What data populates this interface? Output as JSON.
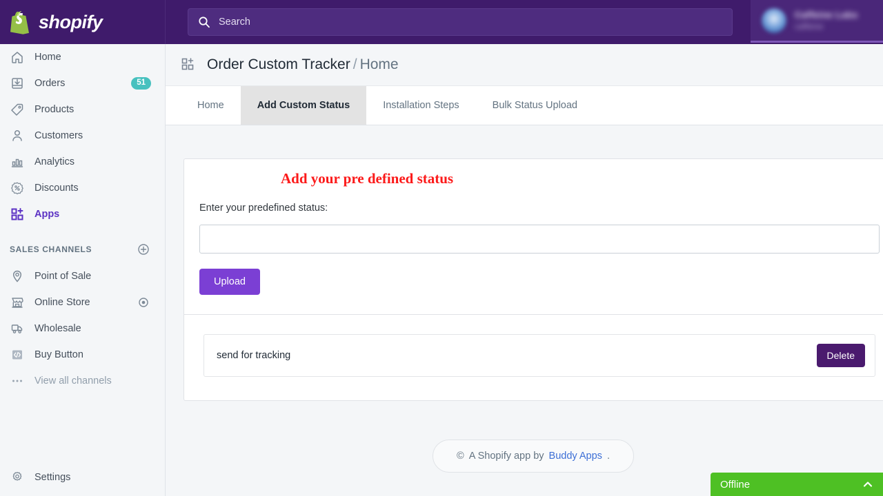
{
  "topbar": {
    "brand_name": "shopify",
    "brand_icon": "shopify-bag-icon",
    "search": {
      "placeholder": "Search",
      "value": "",
      "icon": "search-icon"
    },
    "account": {
      "name": "Caffeine Labs",
      "subtitle": "caffeine",
      "avatar_icon": "user-avatar",
      "blurred": true
    }
  },
  "sidebar": {
    "items": [
      {
        "label": "Home",
        "icon": "home-icon",
        "badge": null,
        "active": false
      },
      {
        "label": "Orders",
        "icon": "orders-inbox-icon",
        "badge": "51",
        "active": false
      },
      {
        "label": "Products",
        "icon": "products-tag-icon",
        "badge": null,
        "active": false
      },
      {
        "label": "Customers",
        "icon": "customers-person-icon",
        "badge": null,
        "active": false
      },
      {
        "label": "Analytics",
        "icon": "analytics-bar-chart-icon",
        "badge": null,
        "active": false
      },
      {
        "label": "Discounts",
        "icon": "discounts-percent-icon",
        "badge": null,
        "active": false
      },
      {
        "label": "Apps",
        "icon": "apps-grid-plus-icon",
        "badge": null,
        "active": true
      }
    ],
    "section": {
      "title": "SALES CHANNELS",
      "add_icon": "plus-circle-icon"
    },
    "channels": [
      {
        "label": "Point of Sale",
        "icon": "location-pin-icon",
        "trailing_icon": null
      },
      {
        "label": "Online Store",
        "icon": "storefront-icon",
        "trailing_icon": "eye-icon"
      },
      {
        "label": "Wholesale",
        "icon": "truck-icon",
        "trailing_icon": null
      },
      {
        "label": "Buy Button",
        "icon": "code-brackets-icon",
        "trailing_icon": null
      },
      {
        "label": "View all channels",
        "icon": "ellipsis-icon",
        "trailing_icon": null
      }
    ],
    "settings": {
      "label": "Settings",
      "icon": "gear-icon"
    }
  },
  "page": {
    "icon": "apps-grid-plus-icon",
    "title": "Order Custom Tracker",
    "separator": "/",
    "breadcrumb_current": "Home"
  },
  "tabs": [
    {
      "label": "Home",
      "active": false
    },
    {
      "label": "Add Custom Status",
      "active": true
    },
    {
      "label": "Installation Steps",
      "active": false
    },
    {
      "label": "Bulk Status Upload",
      "active": false
    }
  ],
  "form": {
    "heading": "Add your pre defined status",
    "heading_color": "#fc1a1a",
    "field_label": "Enter your predefined status:",
    "input_value": "",
    "input_placeholder": "",
    "upload_button": "Upload",
    "upload_button_color": "#7b3fd4"
  },
  "status_list": [
    {
      "name": "send for tracking",
      "delete_label": "Delete"
    }
  ],
  "delete_button_color": "#4a1a6e",
  "footer": {
    "copyright_symbol": "©",
    "text": "A Shopify app by",
    "link": "Buddy Apps",
    "period": "."
  },
  "chat_widget": {
    "label": "Offline",
    "color": "#4ec024",
    "chevron_icon": "chevron-up-icon"
  }
}
